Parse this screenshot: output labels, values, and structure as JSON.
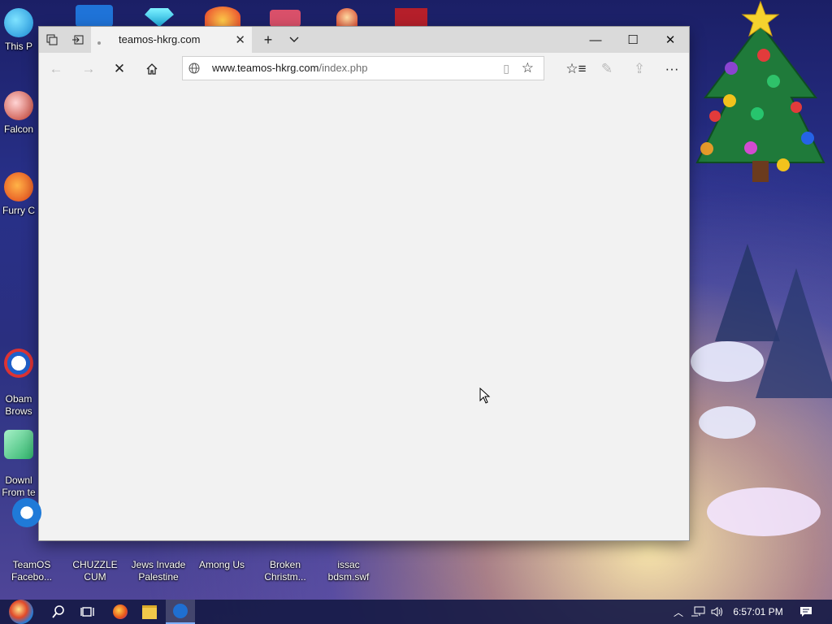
{
  "desktop": {
    "left_icons": [
      {
        "label": "This P"
      },
      {
        "label": "Falcon"
      },
      {
        "label": "Furry C"
      },
      {
        "label": "Obam\nBrows"
      },
      {
        "label": "Downl\nFrom te"
      }
    ],
    "bottom_icons": [
      {
        "label": "TeamOS\nFacebo..."
      },
      {
        "label": "CHUZZLE\nCUM"
      },
      {
        "label": "Jews Invade\nPalestine"
      },
      {
        "label": "Among Us"
      },
      {
        "label": "Broken\nChristm..."
      },
      {
        "label": "issac\nbdsm.swf"
      }
    ]
  },
  "browser": {
    "tab_title": "teamos-hkrg.com",
    "url_host": "www.teamos-hkrg.com",
    "url_path": "/index.php",
    "window_controls": {
      "minimize": "—",
      "maximize": "☐",
      "close": "✕"
    }
  },
  "taskbar": {
    "clock": "6:57:01 PM"
  },
  "colors": {
    "titlebar": "#dadada",
    "browser_bg": "#f2f2f2",
    "taskbar": "#161a46"
  }
}
